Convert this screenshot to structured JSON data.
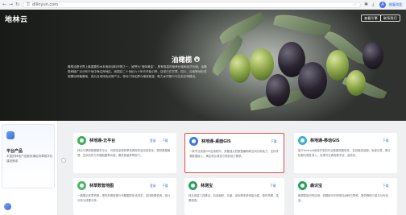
{
  "browser": {
    "url": "dilinyun.com",
    "profile_initial": "A",
    "resume_label": "恢复浏览",
    "icons": [
      "back-arrow-icon",
      "forward-arrow-icon",
      "reload-icon",
      "lock-icon",
      "star-icon",
      "extensions-icon",
      "download-icon"
    ]
  },
  "header": {
    "logo": "地林云",
    "buttons": {
      "guide": "查看引擎",
      "contact": "联系我们"
    }
  },
  "hero": {
    "title": "油橄榄",
    "caption_icon": "▲",
    "description": "橄榄油是世界上最重要的木本食用油料作物之一，被誉为“液体黄金”，具有极高的营养价值和经济价值。油橄榄种植广泛分布于地中海沿岸地区，我国自二十世纪六十年代开始引种，目前已在甘肃、四川、云南等地形成规模化种植基地，成为当地特色优势产业，带动了林区群众增收致富，助力乡村振兴与生态文明建设。"
  },
  "sidebar": {
    "title": "平台产品",
    "description": "丰富的林地产品服务满足林草数字化建设需求"
  },
  "cards": [
    {
      "title": "林地通-云平台",
      "links": [
        "登录",
        "下载"
      ],
      "description": "林业与草原数据服务平台，可视化呈现林草资源现状及动态变化，提供数据管理、空间分析与专题制图等功能，服务各级林草部门。",
      "color": "#3fae5a"
    },
    {
      "title": "林地通-桌面GIS",
      "links": [
        "下载"
      ],
      "description": "一款专业桌面GIS应用软件，具备强大的数据编辑和空间分析能力，支持多源数据接入，满足林业调查与规划设计需求。",
      "color": "#3b7be0"
    },
    {
      "title": "林地通-移动GIS",
      "links": [
        "下载"
      ],
      "description": "基于Android系统开发的外业数据采集软件，支持离线地图、轨迹记录、照片拍摄与属性录入，实现外业调查数字化、高效化。",
      "color": "#3bb0c9"
    },
    {
      "title": "林草数智地图",
      "links": [
        "登录",
        "下载"
      ],
      "description": "一图展示林草资源，提供多源影像与专题图层在线浏览，支持数据查询、统计分析与成果共享。",
      "color": "#4bb56a"
    },
    {
      "title": "林测宝",
      "links": [
        "下载"
      ],
      "description": "林业测量工具集合，包含面积、长度、坐标等多种测量功能，操作简便，结果精准。",
      "color": "#2fa15a"
    },
    {
      "title": "森识宝",
      "links": [
        "下载"
      ],
      "description": "植物智能识别应用，拍照即可识别常见树种与草种，提供物种介绍与分布信息。",
      "color": "#28a05c"
    }
  ]
}
